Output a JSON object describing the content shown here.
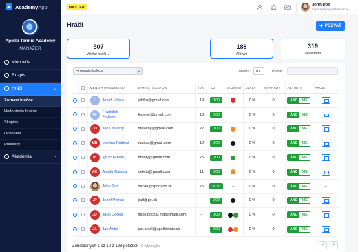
{
  "app": {
    "name_bold": "Academy",
    "name_light": "App"
  },
  "club": {
    "name": "Apollo Tennis Academy",
    "role": "MANAŽER"
  },
  "sidebar": {
    "items": [
      {
        "label": "Klubovňa",
        "icon": "home-icon"
      },
      {
        "label": "Rozpis",
        "icon": "clock-icon"
      },
      {
        "label": "Hráči",
        "icon": "people-icon"
      }
    ],
    "sub_items": [
      "Zoznam hráčov",
      "Hodnotenia hráčov",
      "Skupiny",
      "Ocenenia",
      "Prihlášky"
    ],
    "academy": {
      "label": "Akadémia",
      "icon": "graduation-icon"
    }
  },
  "topbar": {
    "badge": "MASTER",
    "user_name": "John Doe",
    "user_email": "manazer@apollotenisacad...",
    "icons": [
      "user-icon",
      "bell-icon",
      "mail-icon"
    ]
  },
  "page": {
    "title": "Hráči",
    "add_button": "POZVAŤ"
  },
  "stats": [
    {
      "value": "507",
      "label": "Všetci hráči"
    },
    {
      "value": "188",
      "label": "Aktívni"
    },
    {
      "value": "319",
      "label": "Neaktívni"
    }
  ],
  "controls": {
    "bulk_action": "Hromadná akcia",
    "show_label": "Zobraziť:",
    "show_value": "10",
    "search_label": "Hľadať:",
    "search_placeholder": ""
  },
  "table": {
    "headers": [
      "MENO A PRIEZVISKO",
      "E-MAIL, TELEFÓN",
      "VEK",
      "CZ",
      "SKUPINA",
      "ZĽAVA",
      "NÁHRADY",
      "AKTIVITA",
      "AKCIE"
    ],
    "toggle_yes": "ÁNO",
    "toggle_no": "NIE",
    "rows": [
      {
        "initials": "JJ",
        "av_color": "#9db7e8",
        "name": "Jozef Jabiko",
        "email": "jabiko@gmail.com",
        "age": "19",
        "cz": "0.00",
        "groups": [
          "#e02a2a"
        ],
        "discount": "0 %",
        "subs": "0",
        "action": "mail"
      },
      {
        "initials": "FF",
        "av_color": "#9db7e8",
        "name": "František Federer",
        "email": "federer@gmail.com",
        "age": "13",
        "cz": "0.00",
        "groups": [],
        "discount": "0 %",
        "subs": "0",
        "action": "mail"
      },
      {
        "initials": "JD",
        "av_color": "#d32f2f",
        "name": "Ján Drevený",
        "email": "dreveny@gmail.com",
        "age": "22",
        "cz": "0.00",
        "groups": [
          "#f28c1a"
        ],
        "discount": "0 %",
        "subs": "0",
        "action": "mail"
      },
      {
        "initials": "MR",
        "av_color": "#d32f2f",
        "name": "Martina Ružová",
        "email": "ruzova@gmail.com",
        "age": "19",
        "cz": "0.00",
        "groups": [
          "#111111"
        ],
        "discount": "0 %",
        "subs": "0",
        "action": "mail"
      },
      {
        "initials": "IH",
        "av_color": "#d32f2f",
        "name": "Ignác Hrbatý",
        "email": "hrbaty@gmail.com",
        "age": "25",
        "cz": "0.00",
        "groups": [
          "#2e9e3a"
        ],
        "discount": "0 %",
        "subs": "0",
        "action": "mail"
      },
      {
        "initials": "AR",
        "av_color": "#d32f2f",
        "name": "Aladár Raketa",
        "email": "raketa@gmail.com",
        "age": "11",
        "cz": "0.00",
        "groups": [
          "#f28c1a"
        ],
        "discount": "0 %",
        "subs": "0",
        "action": "mail"
      },
      {
        "initials": "",
        "av_color": "#8a6a52",
        "photo": true,
        "name": "John Doe",
        "email": "daniel@sportzoo.sk",
        "age": "26",
        "cz": "36.90",
        "groups": [],
        "group_text": "–",
        "discount": "0 %",
        "subs": "0",
        "action": "dash"
      },
      {
        "initials": "JP",
        "av_color": "#d32f2f",
        "name": "Jozef Petran",
        "email": "jozl@pe.sk",
        "age": "–",
        "cz": "0.00",
        "groups": [
          "#111111"
        ],
        "discount": "0 %",
        "subs": "0",
        "action": "mail"
      },
      {
        "initials": "JD",
        "av_color": "#d32f2f",
        "name": "Juraj Dockal",
        "email": "miso.dockal.md@gmail.com",
        "age": "–",
        "cz": "0.00",
        "groups": [
          "#111111",
          "#2e9e3a"
        ],
        "discount": "0 %",
        "subs": "0",
        "action": "mail"
      },
      {
        "initials": "JA",
        "av_color": "#d32f2f",
        "name": "Jan Antol",
        "email": "jan.antol@apollotenis.sk",
        "age": "–",
        "cz": "0.00",
        "groups": [
          "#e02a2a",
          "#f28c1a"
        ],
        "discount": "0 %",
        "subs": "0",
        "action": "mail"
      }
    ]
  },
  "footer": {
    "summary": "Zobrazených 1 až 10 z 188 položiek",
    "selected": "0 vybraných"
  },
  "colors": {
    "primary": "#1f7dff",
    "sidebar": "#0f1c3d",
    "success": "#1f9d3a",
    "badge": "#ffe94d"
  }
}
